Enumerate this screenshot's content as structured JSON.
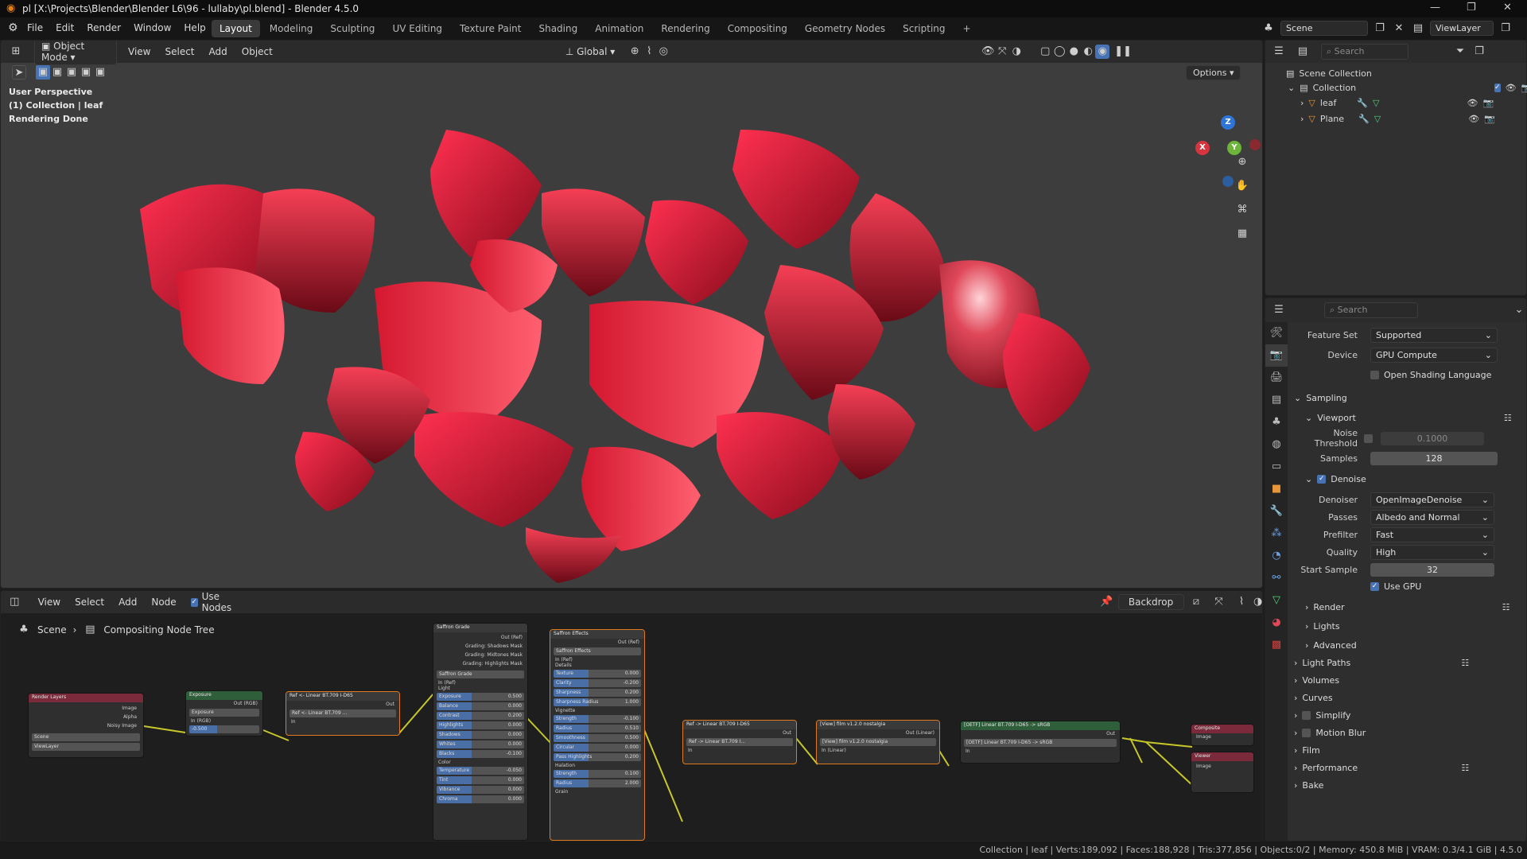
{
  "window": {
    "title": "pl [X:\\Projects\\Blender\\Blender L6\\96 - lullaby\\pl.blend] - Blender 4.5.0"
  },
  "menus": [
    "File",
    "Edit",
    "Render",
    "Window",
    "Help"
  ],
  "workspaces": [
    "Layout",
    "Modeling",
    "Sculpting",
    "UV Editing",
    "Texture Paint",
    "Shading",
    "Animation",
    "Rendering",
    "Compositing",
    "Geometry Nodes",
    "Scripting"
  ],
  "active_workspace": "Layout",
  "scene_selector": {
    "scene": "Scene",
    "view_layer": "ViewLayer"
  },
  "viewport": {
    "mode": "Object Mode",
    "menu": [
      "View",
      "Select",
      "Add",
      "Object"
    ],
    "orientation": "Global",
    "options_label": "Options",
    "overlay": [
      "User Perspective",
      "(1) Collection | leaf",
      "Rendering Done"
    ],
    "gizmo": {
      "x": "X",
      "y": "Y",
      "z": "Z"
    },
    "colors": {
      "bg": "#3d3d3d",
      "leaf": "#e0142c"
    }
  },
  "node_editor": {
    "menu": [
      "View",
      "Select",
      "Add",
      "Node"
    ],
    "use_nodes_label": "Use Nodes",
    "backdrop_label": "Backdrop",
    "breadcrumb": [
      "Scene",
      "Compositing Node Tree"
    ],
    "nodes": {
      "render_layers": {
        "title": "Render Layers",
        "outputs": [
          "Image",
          "Alpha",
          "Noisy Image"
        ],
        "scene": "Scene",
        "layer": "ViewLayer"
      },
      "exposure": {
        "title": "Exposure",
        "out": "Out (RGB)",
        "input": "In (RGB)",
        "exposure_label": "Exposure",
        "exposure_val": "-0.500"
      },
      "ref_in": {
        "title": "Ref <- Linear BT.709 I-D65",
        "out": "Out",
        "inner": "Ref <- Linear BT.709 ...",
        "in": "In"
      },
      "saffron_grade": {
        "title": "Saffron Grade",
        "outs": [
          "Out (Ref)",
          "Grading: Shadows Mask",
          "Grading: Midtones Mask",
          "Grading: Highlights Mask"
        ],
        "inner": "Saffron Grade",
        "in": "In (Ref)",
        "light_label": "Light",
        "light": [
          [
            "Exposure",
            "0.500"
          ],
          [
            "Balance",
            "0.000"
          ],
          [
            "Contrast",
            "0.200"
          ],
          [
            "Highlights",
            "0.000"
          ],
          [
            "Shadows",
            "0.000"
          ],
          [
            "Whites",
            "0.000"
          ],
          [
            "Blacks",
            "-0.100"
          ]
        ],
        "color_label": "Color",
        "color": [
          [
            "Temperature",
            "-0.050"
          ],
          [
            "Tint",
            "0.000"
          ],
          [
            "Vibrance",
            "0.000"
          ],
          [
            "Chroma",
            "0.000"
          ]
        ]
      },
      "saffron_effects": {
        "title": "Saffron Effects",
        "out": "Out (Ref)",
        "inner": "Saffron Effects",
        "in": "In (Ref)",
        "details_label": "Details",
        "details": [
          [
            "Texture",
            "0.000"
          ],
          [
            "Clarity",
            "-0.200"
          ],
          [
            "Sharpness",
            "0.200"
          ],
          [
            "Sharpness Radius",
            "1.000"
          ]
        ],
        "vignette_label": "Vignette",
        "vignette": [
          [
            "Strength",
            "-0.100"
          ],
          [
            "Radius",
            "0.510"
          ],
          [
            "Smoothness",
            "0.500"
          ],
          [
            "Circular",
            "0.000"
          ],
          [
            "Pass Highlights",
            "0.200"
          ]
        ],
        "halation_label": "Halation",
        "halation": [
          [
            "Strength",
            "0.100"
          ],
          [
            "Radius",
            "2.000"
          ]
        ],
        "grain_label": "Grain"
      },
      "ref_out": {
        "title": "Ref -> Linear BT.709 I-D65",
        "out": "Out",
        "inner": "Ref -> Linear BT.709 I...",
        "in": "In"
      },
      "view_film": {
        "title": "[View] film v1.2.0 nostalgia",
        "out": "Out (Linear)",
        "inner": "[View] film v1.2.0 nostalgia",
        "in": "In (Linear)"
      },
      "oetf": {
        "title": "[OETF] Linear BT.709 I-D65 -> sRGB",
        "out": "Out",
        "inner": "[OETF] Linear BT.709 I-D65 -> sRGB",
        "in": "In"
      },
      "composite": {
        "title": "Composite",
        "input": "Image"
      },
      "viewer": {
        "title": "Viewer",
        "input": "Image"
      }
    }
  },
  "outliner": {
    "search_placeholder": "Search",
    "root": "Scene Collection",
    "collection": "Collection",
    "items": [
      "leaf",
      "Plane"
    ]
  },
  "properties": {
    "search_placeholder": "Search",
    "feature_set": {
      "label": "Feature Set",
      "value": "Supported"
    },
    "device": {
      "label": "Device",
      "value": "GPU Compute"
    },
    "osl": "Open Shading Language",
    "sampling": "Sampling",
    "viewport_label": "Viewport",
    "noise_threshold": {
      "label": "Noise Threshold",
      "value": "0.1000"
    },
    "samples": {
      "label": "Samples",
      "value": "128"
    },
    "denoise": "Denoise",
    "denoiser": {
      "label": "Denoiser",
      "value": "OpenImageDenoise"
    },
    "passes": {
      "label": "Passes",
      "value": "Albedo and Normal"
    },
    "prefilter": {
      "label": "Prefilter",
      "value": "Fast"
    },
    "quality": {
      "label": "Quality",
      "value": "High"
    },
    "start_sample": {
      "label": "Start Sample",
      "value": "32"
    },
    "use_gpu": "Use GPU",
    "subpanels": [
      "Render",
      "Lights",
      "Advanced"
    ],
    "panels": [
      "Light Paths",
      "Volumes",
      "Curves",
      "Simplify",
      "Motion Blur",
      "Film",
      "Performance",
      "Bake"
    ]
  },
  "status": "Collection | leaf | Verts:189,092 | Faces:188,928 | Tris:377,856 | Objects:0/2 | Memory: 450.8 MiB | VRAM: 0.3/4.1 GiB | 4.5.0"
}
